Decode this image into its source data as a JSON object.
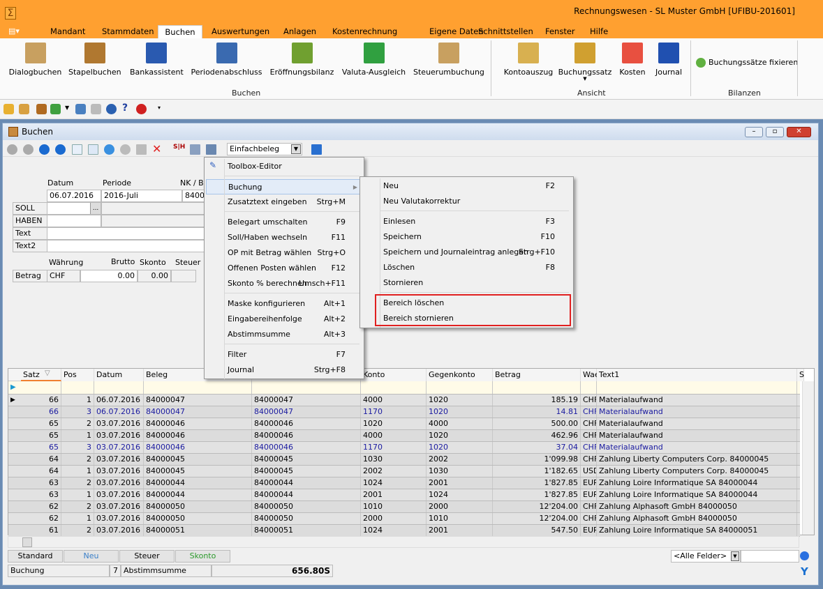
{
  "app": {
    "title": "Rechnungswesen - SL Muster GmbH [UFIBU-201601]",
    "icon": "sigma-icon"
  },
  "tabs": [
    "Mandant",
    "Stammdaten",
    "Buchen",
    "Auswertungen",
    "Anlagen",
    "Kostenrechnung",
    "Eigene Daten",
    "Schnittstellen",
    "Fenster",
    "Hilfe"
  ],
  "active_tab": "Buchen",
  "ribbon": {
    "buchen": [
      "Dialogbuchen",
      "Stapelbuchen",
      "Bankassistent",
      "Periodenabschluss",
      "Eröffnungsbilanz",
      "Valuta-Ausgleich",
      "Steuerumbuchung"
    ],
    "buchen_label": "Buchen",
    "ansicht": [
      "Kontoauszug",
      "Buchungssatz",
      "Kosten",
      "Journal"
    ],
    "ansicht_label": "Ansicht",
    "bilanzen_button": "Buchungssätze fixieren",
    "bilanzen_label": "Bilanzen"
  },
  "window": {
    "title": "Buchen",
    "belegart": "Einfachbeleg"
  },
  "form": {
    "datum_label": "Datum",
    "periode_label": "Periode",
    "nk_label": "NK / Be",
    "datum": "06.07.2016",
    "periode": "2016-Juli",
    "nk": "84000",
    "soll": "SOLL",
    "haben": "HABEN",
    "text": "Text",
    "text2": "Text2",
    "waehrung_label": "Währung",
    "brutto_label": "Brutto",
    "skonto_label": "Skonto",
    "steuer_label": "Steuer",
    "betrag_label": "Betrag",
    "waehrung": "CHF",
    "brutto": "0.00",
    "skonto": "0.00"
  },
  "context_menu": {
    "items": [
      {
        "label": "Toolbox-Editor",
        "shortcut": ""
      },
      {
        "label": "Buchung",
        "shortcut": "",
        "submenu": true
      },
      {
        "label": "Zusatztext eingeben",
        "shortcut": "Strg+M"
      },
      {
        "label": "Belegart umschalten",
        "shortcut": "F9"
      },
      {
        "label": "Soll/Haben wechseln",
        "shortcut": "F11"
      },
      {
        "label": "OP mit Betrag wählen",
        "shortcut": "Strg+O"
      },
      {
        "label": "Offenen Posten wählen",
        "shortcut": "F12"
      },
      {
        "label": "Skonto % berechnen",
        "shortcut": "Umsch+F11"
      },
      {
        "label": "Maske konfigurieren",
        "shortcut": "Alt+1"
      },
      {
        "label": "Eingabereihenfolge",
        "shortcut": "Alt+2"
      },
      {
        "label": "Abstimmsumme",
        "shortcut": "Alt+3"
      },
      {
        "label": "Filter",
        "shortcut": "F7"
      },
      {
        "label": "Journal",
        "shortcut": "Strg+F8"
      }
    ]
  },
  "submenu": {
    "items": [
      {
        "label": "Neu",
        "shortcut": "F2"
      },
      {
        "label": "Neu Valutakorrektur",
        "shortcut": ""
      },
      {
        "label": "Einlesen",
        "shortcut": "F3"
      },
      {
        "label": "Speichern",
        "shortcut": "F10"
      },
      {
        "label": "Speichern und Journaleintrag anlegen",
        "shortcut": "Strg+F10"
      },
      {
        "label": "Löschen",
        "shortcut": "F8"
      },
      {
        "label": "Stornieren",
        "shortcut": ""
      },
      {
        "label": "Bereich löschen",
        "shortcut": ""
      },
      {
        "label": "Bereich stornieren",
        "shortcut": ""
      }
    ],
    "highlight_color": "#e02020"
  },
  "grid": {
    "columns": [
      "Satz",
      "Pos",
      "Datum",
      "Beleg",
      "",
      "Konto",
      "Gegenkonto",
      "Betrag",
      "Wae",
      "Text1",
      "S"
    ],
    "rows": [
      [
        "66",
        "1",
        "06.07.2016",
        "84000047",
        "84000047",
        "4000",
        "1020",
        "185.19",
        "CHF",
        "Materialaufwand"
      ],
      [
        "66",
        "3",
        "06.07.2016",
        "84000047",
        "84000047",
        "1170",
        "1020",
        "14.81",
        "CHF",
        "Materialaufwand"
      ],
      [
        "65",
        "2",
        "03.07.2016",
        "84000046",
        "84000046",
        "1020",
        "4000",
        "500.00",
        "CHF",
        "Materialaufwand"
      ],
      [
        "65",
        "1",
        "03.07.2016",
        "84000046",
        "84000046",
        "4000",
        "1020",
        "462.96",
        "CHF",
        "Materialaufwand"
      ],
      [
        "65",
        "3",
        "03.07.2016",
        "84000046",
        "84000046",
        "1170",
        "1020",
        "37.04",
        "CHF",
        "Materialaufwand"
      ],
      [
        "64",
        "2",
        "03.07.2016",
        "84000045",
        "84000045",
        "1030",
        "2002",
        "1'099.98",
        "CHF",
        "Zahlung Liberty Computers Corp. 84000045"
      ],
      [
        "64",
        "1",
        "03.07.2016",
        "84000045",
        "84000045",
        "2002",
        "1030",
        "1'182.65",
        "USD",
        "Zahlung Liberty Computers Corp. 84000045"
      ],
      [
        "63",
        "2",
        "03.07.2016",
        "84000044",
        "84000044",
        "1024",
        "2001",
        "1'827.85",
        "EUR",
        "Zahlung Loire Informatique SA 84000044"
      ],
      [
        "63",
        "1",
        "03.07.2016",
        "84000044",
        "84000044",
        "2001",
        "1024",
        "1'827.85",
        "EUR",
        "Zahlung Loire Informatique SA 84000044"
      ],
      [
        "62",
        "2",
        "03.07.2016",
        "84000050",
        "84000050",
        "1010",
        "2000",
        "12'204.00",
        "CHF",
        "Zahlung Alphasoft GmbH 84000050"
      ],
      [
        "62",
        "1",
        "03.07.2016",
        "84000050",
        "84000050",
        "2000",
        "1010",
        "12'204.00",
        "CHF",
        "Zahlung Alphasoft GmbH 84000050"
      ],
      [
        "61",
        "2",
        "03.07.2016",
        "84000051",
        "84000051",
        "1024",
        "2001",
        "547.50",
        "EUR",
        "Zahlung Loire Informatique SA 84000051"
      ]
    ],
    "blue_rows": [
      1,
      4
    ]
  },
  "bottom_tabs": [
    {
      "label": "Standard",
      "color": "#000000"
    },
    {
      "label": "Neu",
      "color": "#3a7fc8"
    },
    {
      "label": "Steuer",
      "color": "#000000"
    },
    {
      "label": "Skonto",
      "color": "#2a9a2a"
    }
  ],
  "search": {
    "field": "<Alle Felder>",
    "value": ""
  },
  "status": {
    "mode": "Buchung",
    "count": "7",
    "sum_label": "Abstimmsumme",
    "sum": "656.80S"
  }
}
